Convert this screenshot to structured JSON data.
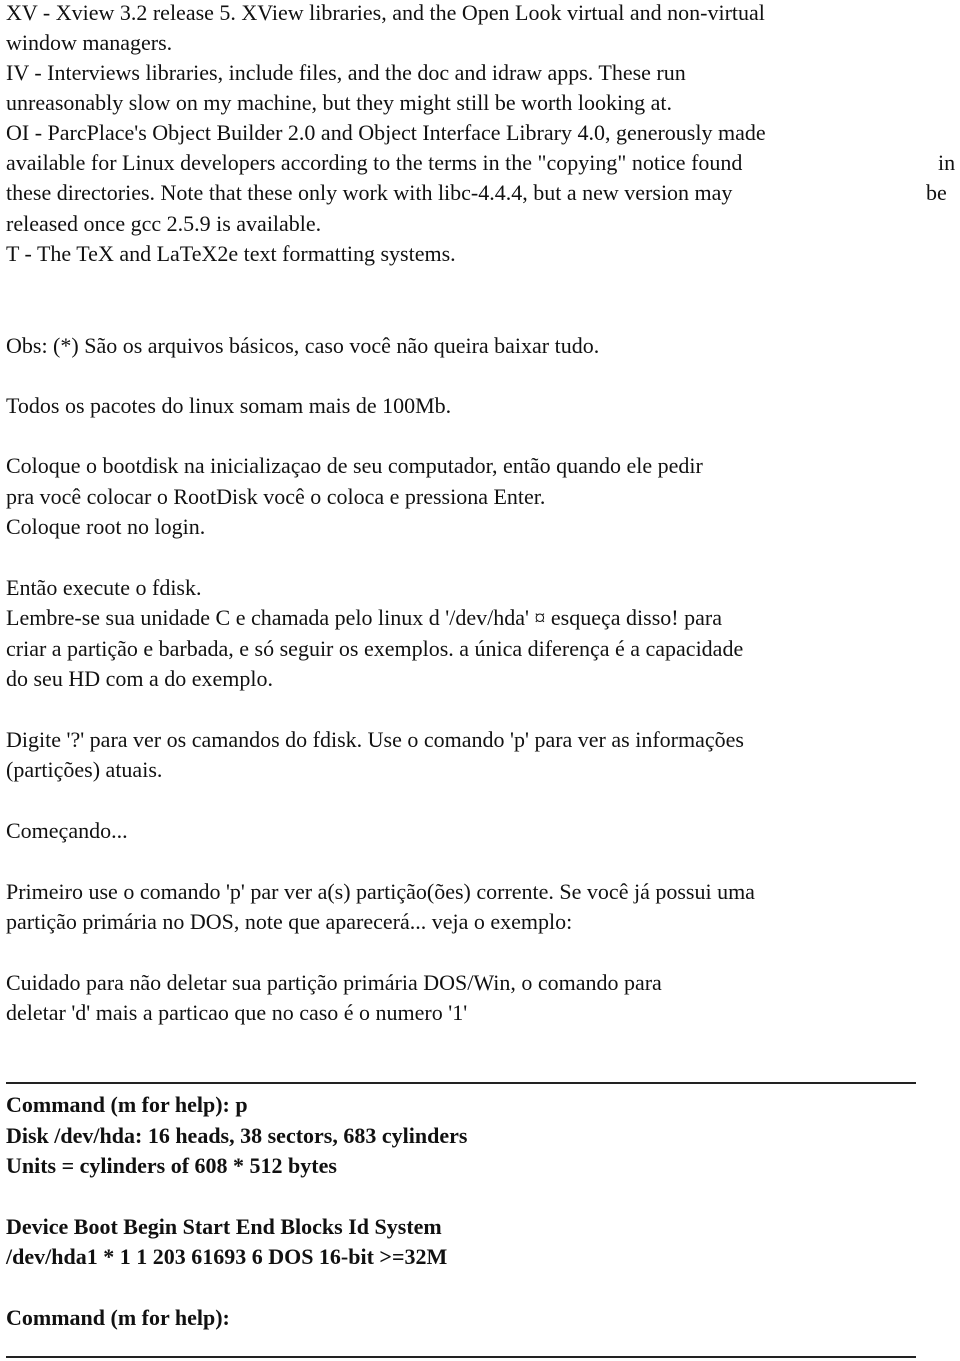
{
  "paragraphs": {
    "p1": [
      "XV - Xview 3.2 release 5. XView libraries, and the Open Look virtual and non-virtual",
      "window managers.",
      "IV - Interviews libraries, include files, and the doc and idraw apps. These run",
      "unreasonably slow on my machine, but they might still be worth looking at.",
      "OI - ParcPlace's Object Builder 2.0 and Object Interface Library 4.0, generously made",
      "available for Linux developers according to the terms in the \"copying\" notice found",
      "these directories. Note that these only work with libc-4.4.4, but a new version may",
      "released once gcc 2.5.9 is available.",
      "T - The TeX and LaTeX2e text formatting systems."
    ],
    "p1_right": [
      "in",
      "be"
    ],
    "obs": "Obs: (*) São os arquivos básicos, caso você não queira baixar tudo.",
    "todos": "Todos os pacotes do linux somam mais de 100Mb.",
    "boot": [
      "Coloque o bootdisk na inicializaçao de seu computador, então quando ele pedir",
      "pra você colocar o RootDisk você o coloca e pressiona Enter.",
      "Coloque root no login."
    ],
    "fdisk": [
      "Então execute o fdisk.",
      "Lembre-se sua unidade C e chamada pelo linux d '/dev/hda' ¤ esqueça disso! para",
      "criar a partição e barbada, e só seguir os exemplos. a única diferença é a capacidade",
      "do seu HD com a do exemplo."
    ],
    "digite": [
      "Digite '?' para ver os camandos do fdisk. Use o comando 'p' para ver as informações",
      "(partições) atuais."
    ],
    "comecando": "Começando...",
    "primeiro": [
      "Primeiro use o comando 'p' par ver a(s) partição(ões) corrente. Se você já possui uma",
      "partição primária no DOS, note que aparecerá... veja o exemplo:"
    ],
    "cuidado": [
      "Cuidado para não deletar sua partição primária DOS/Win, o comando para",
      "deletar 'd' mais a particao que no caso é o numero '1'"
    ]
  },
  "terminal": {
    "command1": "Command (m for help): p",
    "disk": "Disk /dev/hda: 16 heads, 38 sectors, 683 cylinders",
    "units": "Units = cylinders of 608 * 512 bytes",
    "header": "Device Boot Begin Start End Blocks Id System",
    "row": "/dev/hda1 * 1 1 203 61693 6 DOS 16-bit >=32M",
    "command2": "Command (m for help):"
  }
}
